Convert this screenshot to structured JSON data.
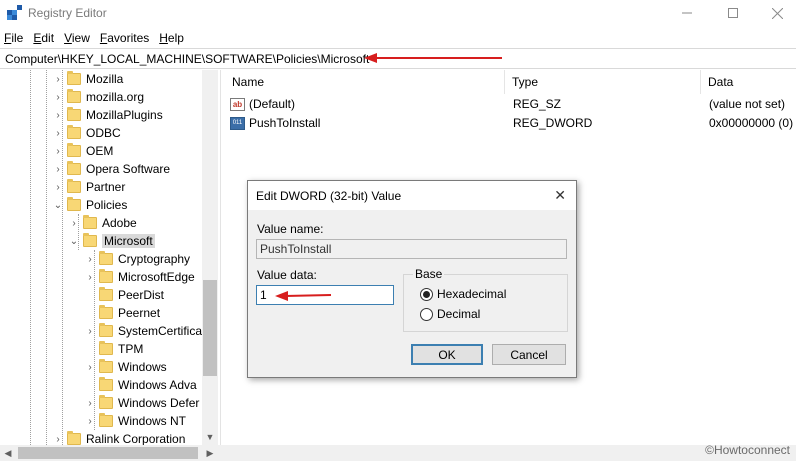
{
  "window": {
    "title": "Registry Editor"
  },
  "menu": {
    "items": [
      {
        "underline": "F",
        "rest": "ile"
      },
      {
        "underline": "E",
        "rest": "dit"
      },
      {
        "underline": "V",
        "rest": "iew"
      },
      {
        "underline": "F",
        "rest": "avorites"
      },
      {
        "underline": "H",
        "rest": "elp"
      }
    ]
  },
  "address": {
    "path": "Computer\\HKEY_LOCAL_MACHINE\\SOFTWARE\\Policies\\Microsoft"
  },
  "tree": {
    "items": [
      {
        "label": "Mozilla"
      },
      {
        "label": "mozilla.org"
      },
      {
        "label": "MozillaPlugins"
      },
      {
        "label": "ODBC"
      },
      {
        "label": "OEM"
      },
      {
        "label": "Opera Software"
      },
      {
        "label": "Partner"
      },
      {
        "label": "Policies"
      },
      {
        "label": "Adobe"
      },
      {
        "label": "Microsoft"
      },
      {
        "label": "Cryptography"
      },
      {
        "label": "MicrosoftEdge"
      },
      {
        "label": "PeerDist"
      },
      {
        "label": "Peernet"
      },
      {
        "label": "SystemCertifica"
      },
      {
        "label": "TPM"
      },
      {
        "label": "Windows"
      },
      {
        "label": "Windows Adva"
      },
      {
        "label": "Windows Defer"
      },
      {
        "label": "Windows NT"
      },
      {
        "label": "Ralink Corporation"
      }
    ]
  },
  "list": {
    "headers": {
      "name": "Name",
      "type": "Type",
      "data": "Data"
    },
    "rows": [
      {
        "icon": "string-value-icon",
        "icon_text": "ab",
        "name": "(Default)",
        "type": "REG_SZ",
        "data": "(value not set)"
      },
      {
        "icon": "dword-value-icon",
        "icon_text": "011",
        "name": "PushToInstall",
        "type": "REG_DWORD",
        "data": "0x00000000 (0)"
      }
    ]
  },
  "dialog": {
    "title": "Edit DWORD (32-bit) Value",
    "value_name_label": "Value name:",
    "value_name": "PushToInstall",
    "value_data_label": "Value data:",
    "value_data": "1",
    "base_label": "Base",
    "hex_label": "Hexadecimal",
    "dec_label": "Decimal",
    "selected_base": "Hexadecimal",
    "ok_label": "OK",
    "cancel_label": "Cancel"
  },
  "watermark": "©Howtoconnect",
  "colors": {
    "annotation_arrow": "#d71e1e",
    "folder": "#f8d775",
    "focus_border": "#3c7fb1"
  }
}
